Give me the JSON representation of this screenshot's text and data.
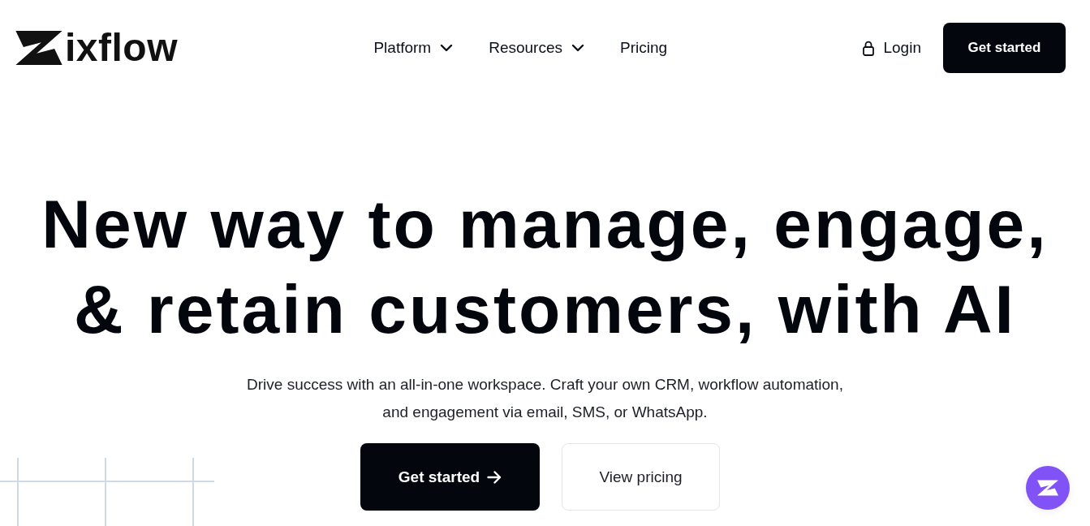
{
  "logo": {
    "name": "ixflow"
  },
  "nav": [
    {
      "label": "Platform",
      "has_menu": true
    },
    {
      "label": "Resources",
      "has_menu": true
    },
    {
      "label": "Pricing",
      "has_menu": false
    }
  ],
  "login": {
    "label": "Login"
  },
  "header_button": {
    "label": "Get started"
  },
  "hero": {
    "headline_lines": [
      "New way to manage, engage,",
      "& retain customers, with AI"
    ],
    "subtitle": "Drive success with an all-in-one workspace. Craft your own CRM, workflow automation, and engagement via email, SMS, or WhatsApp.",
    "buttons": [
      {
        "label": "Get started",
        "kind": "primary"
      },
      {
        "label": "View pricing",
        "kind": "secondary"
      }
    ]
  }
}
